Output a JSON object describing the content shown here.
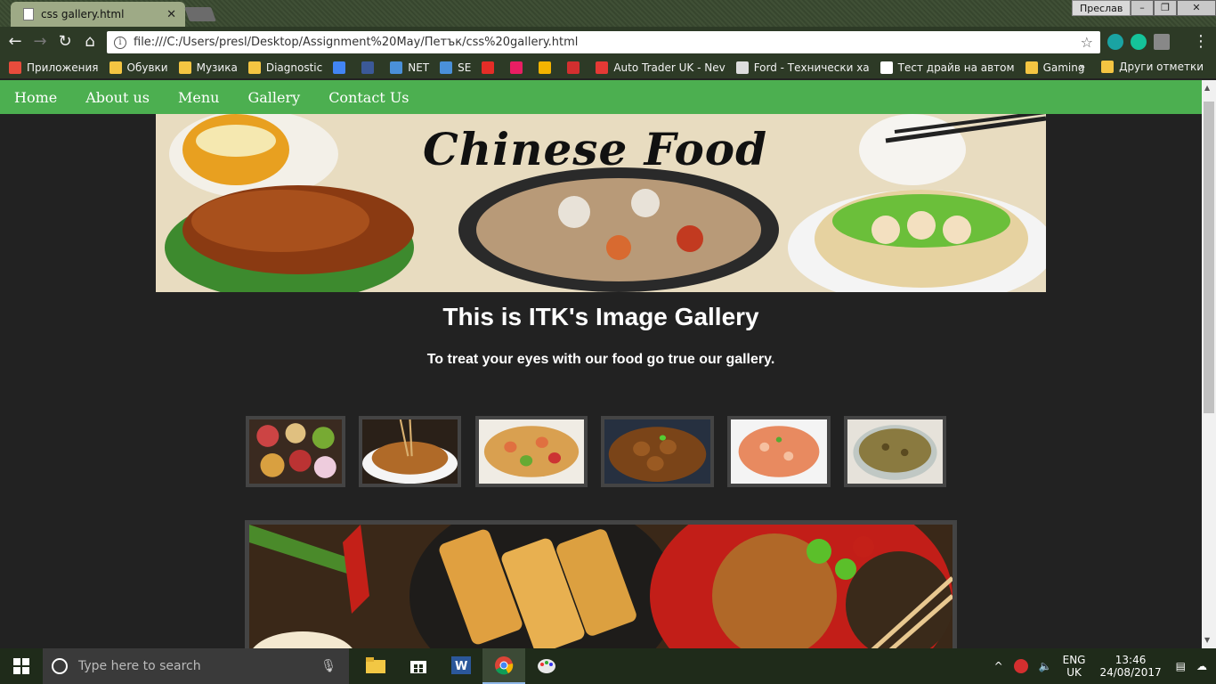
{
  "browser": {
    "tab_title": "css gallery.html",
    "tab_close": "✕",
    "user_name": "Преслав",
    "url": "file:///C:/Users/presl/Desktop/Assignment%20May/Петък/css%20gallery.html",
    "bookmarks": [
      {
        "label": "Приложения",
        "color": "#e74c3c"
      },
      {
        "label": "Обувки",
        "color": "#f4c542"
      },
      {
        "label": "Музика",
        "color": "#f4c542"
      },
      {
        "label": "Diagnostic",
        "color": "#f4c542"
      },
      {
        "label": "",
        "color": "#4285f4"
      },
      {
        "label": "",
        "color": "#3b5998"
      },
      {
        "label": "NET",
        "color": "#4a90d9"
      },
      {
        "label": "SE",
        "color": "#4a90d9"
      },
      {
        "label": "",
        "color": "#e52d27"
      },
      {
        "label": "",
        "color": "#e91e63"
      },
      {
        "label": "",
        "color": "#f4b400"
      },
      {
        "label": "",
        "color": "#d32f2f"
      },
      {
        "label": "Auto Trader UK - Nev",
        "color": "#e53935"
      },
      {
        "label": "Ford - Технически ха",
        "color": "#dddddd"
      },
      {
        "label": "Тест драйв на автом",
        "color": "#ffffff"
      },
      {
        "label": "Gaming",
        "color": "#f4c542"
      }
    ],
    "more_bookmarks": "»",
    "other_bookmarks": "Други отметки"
  },
  "site": {
    "nav": [
      {
        "label": "Home",
        "link": true
      },
      {
        "label": "About us",
        "link": false
      },
      {
        "label": "Menu",
        "link": true
      },
      {
        "label": "Gallery",
        "link": false
      },
      {
        "label": "Contact Us",
        "link": true
      }
    ],
    "banner_text": "Chinese Food",
    "heading": "This is ITK's Image Gallery",
    "subheading": "To treat your eyes with our food go true our gallery."
  },
  "taskbar": {
    "search_placeholder": "Type here to search",
    "lang_top": "ENG",
    "lang_bottom": "UK",
    "time": "13:46",
    "date": "24/08/2017"
  }
}
